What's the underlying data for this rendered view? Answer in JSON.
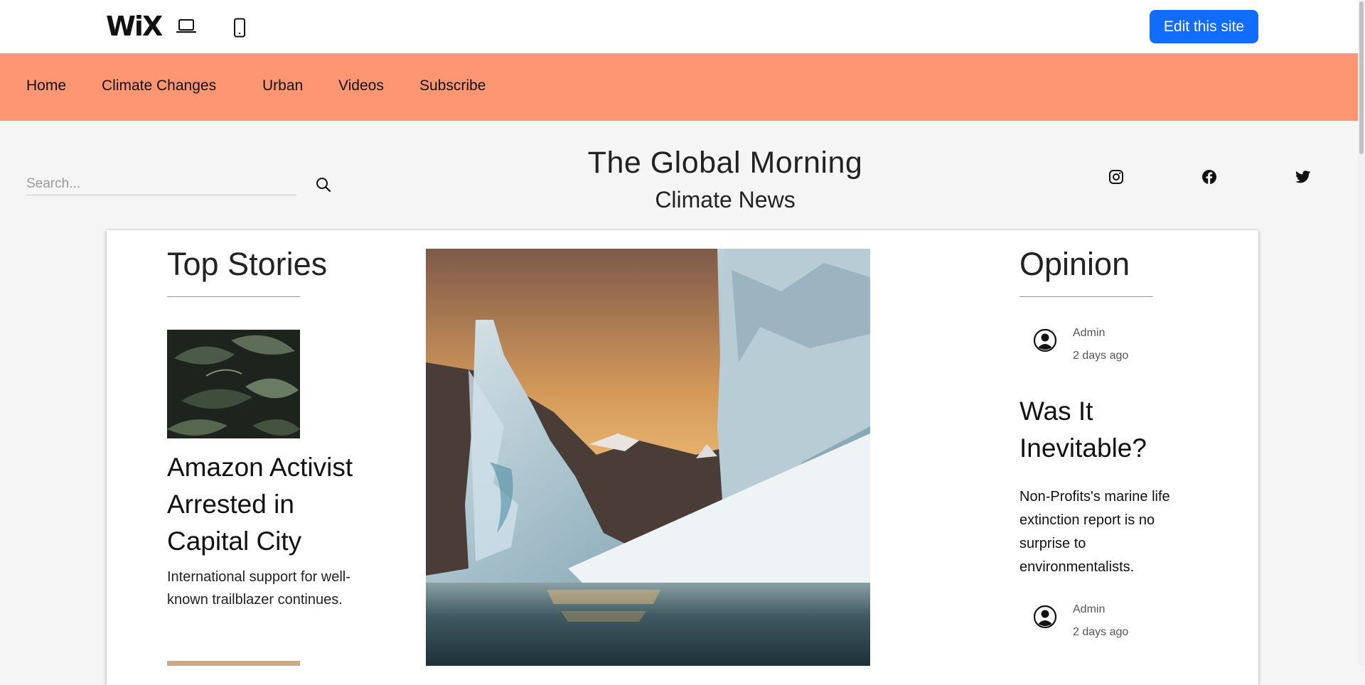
{
  "wix_bar": {
    "logo_text": "WiX",
    "desktop_icon": "laptop-icon",
    "mobile_icon": "mobile-phone-icon",
    "edit_button_label": "Edit this site",
    "edit_button_color": "#116dff"
  },
  "nav": {
    "background_color": "#ff9673",
    "items": [
      {
        "label": "Home"
      },
      {
        "label": "Climate Changes"
      },
      {
        "label": "Urban"
      },
      {
        "label": "Videos"
      },
      {
        "label": "Subscribe"
      }
    ]
  },
  "header": {
    "search_placeholder": "Search...",
    "search_icon": "magnifier-icon",
    "title": "The Global Morning",
    "subtitle": "Climate News",
    "social": [
      {
        "icon": "instagram-icon"
      },
      {
        "icon": "facebook-icon"
      },
      {
        "icon": "twitter-icon"
      }
    ]
  },
  "top_stories": {
    "heading": "Top Stories",
    "story": {
      "title": "Amazon Activist Arrested in Capital City",
      "description": "International support for well-known trailblazer continues."
    }
  },
  "opinion": {
    "heading": "Opinion",
    "posts": [
      {
        "author": "Admin",
        "time": "2 days ago"
      },
      {
        "author": "Admin",
        "time": "2 days ago"
      }
    ],
    "article": {
      "title": "Was It Inevitable?",
      "description": "Non-Profits's marine life extinction report is no surprise to environmentalists."
    }
  }
}
